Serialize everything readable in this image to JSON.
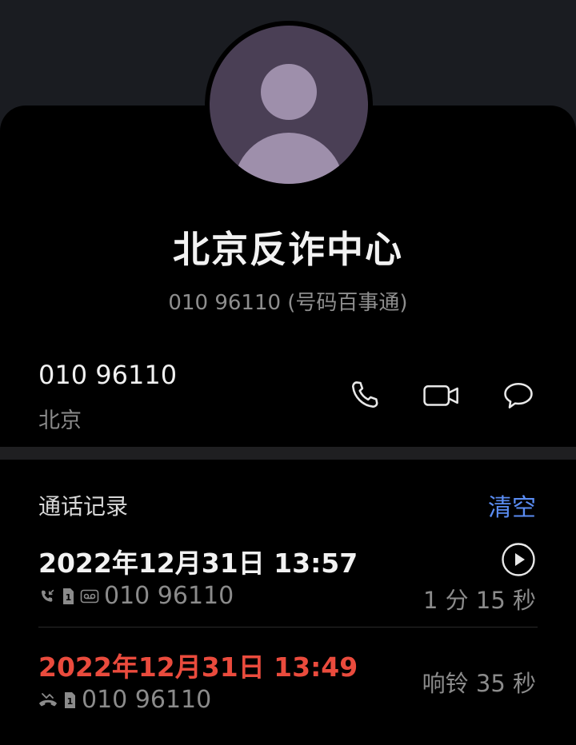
{
  "contact": {
    "name": "北京反诈中心",
    "subtitle": "010 96110 (号码百事通)",
    "number": "010 96110",
    "location": "北京"
  },
  "actions": {
    "call_icon": "phone-icon",
    "video_icon": "video-call-icon",
    "message_icon": "message-icon"
  },
  "call_log": {
    "title": "通话记录",
    "clear_label": "清空",
    "records": [
      {
        "datetime": "2022年12月31日 13:57",
        "number": "010 96110",
        "duration": "1 分 15 秒",
        "type": "incoming-answered",
        "icons": [
          "incoming-call-icon",
          "sim1-icon",
          "voicemail-icon"
        ],
        "has_playback": true
      },
      {
        "datetime": "2022年12月31日 13:49",
        "number": "010 96110",
        "duration": "响铃 35 秒",
        "type": "missed",
        "icons": [
          "missed-call-icon",
          "sim1-icon"
        ],
        "has_playback": false
      }
    ]
  },
  "colors": {
    "background": "#1a1c21",
    "card": "#000000",
    "accent": "#5a8cf2",
    "missed": "#ea4b3d",
    "avatar_bg": "#4a3f55",
    "avatar_fg": "#9e8fab"
  }
}
